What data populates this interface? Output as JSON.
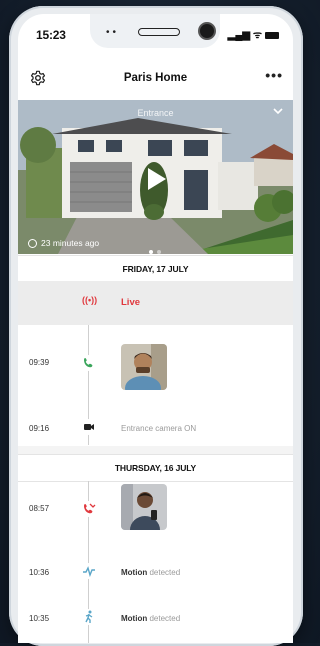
{
  "status_bar": {
    "time": "15:23"
  },
  "header": {
    "title": "Paris Home"
  },
  "camera": {
    "label": "Entrance",
    "time_ago": "23 minutes ago"
  },
  "timeline": {
    "day1": {
      "date": "FRIDAY, 17 JULY",
      "live_label": "Live",
      "events": [
        {
          "time": "09:39",
          "type": "call-answered"
        },
        {
          "time": "09:16",
          "text": "Entrance camera ON"
        }
      ]
    },
    "day2": {
      "date": "THURSDAY, 16 JULY",
      "events": [
        {
          "time": "08:57",
          "type": "call-missed"
        },
        {
          "time": "10:36",
          "label": "Motion",
          "suffix": "detected"
        },
        {
          "time": "10:35",
          "label": "Motion",
          "suffix": "detected"
        }
      ]
    }
  },
  "colors": {
    "live": "#e0393e",
    "call_green": "#3aa55b",
    "call_red": "#e0393e",
    "motion_blue": "#5aa6c8"
  }
}
